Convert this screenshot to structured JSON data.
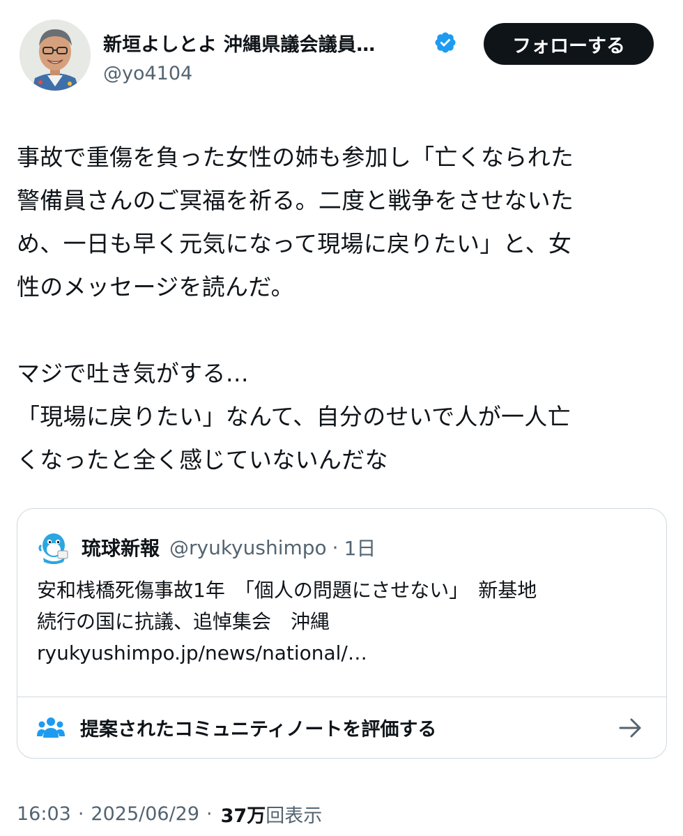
{
  "author": {
    "display_name": "新垣よしとよ 沖縄県議会議員…",
    "handle": "@yo4104",
    "verified_icon": "verified-badge-icon",
    "follow_label": "フォローする"
  },
  "tweet": {
    "paragraph1": [
      "事故で重傷を負った女性の姉も参加し「亡くなられた",
      "警備員さんのご冥福を祈る。二度と戦争をさせないた",
      "め、一日も早く元気になって現場に戻りたい」と、女",
      "性のメッセージを読んだ。"
    ],
    "paragraph2": [
      "マジで吐き気がする…",
      "「現場に戻りたい」なんて、自分のせいで人が一人亡",
      "くなったと全く感じていないんだな"
    ]
  },
  "quote": {
    "name": "琉球新報",
    "handle": "@ryukyushimpo",
    "separator": "·",
    "time": "1日",
    "lines": [
      "安和桟橋死傷事故1年　「個人の問題にさせない」　新基地",
      "続行の国に抗議、追悼集会　沖縄",
      "ryukyushimpo.jp/news/national/…"
    ],
    "note_label": "提案されたコミュニティノートを評価する"
  },
  "meta": {
    "time": "16:03",
    "separator": "·",
    "date": "2025/06/29",
    "views_count": "37万",
    "views_label": "回表示"
  },
  "colors": {
    "text": "#0f1419",
    "secondary": "#536471",
    "verified": "#1d9bf0",
    "border": "#cfd9de",
    "follow_bg": "#0f1419"
  }
}
